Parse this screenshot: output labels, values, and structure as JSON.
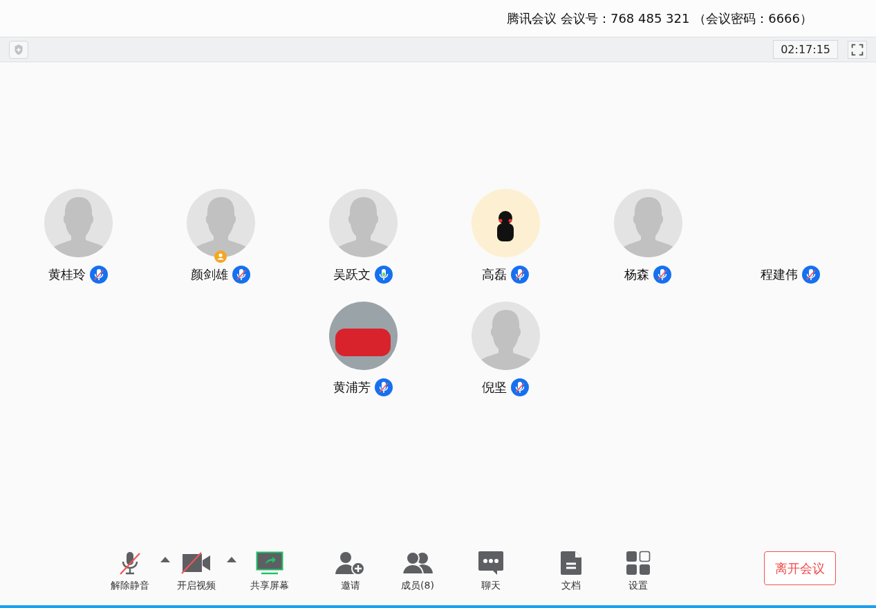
{
  "header": {
    "title": "腾讯会议 会议号：768 485 321 （会议密码：6666）"
  },
  "info_bar": {
    "timer": "02:17:15"
  },
  "participant_rows": [
    [
      {
        "name": "黄桂玲",
        "kind": "default",
        "muted": true,
        "host": false
      },
      {
        "name": "颜剑雄",
        "kind": "default",
        "muted": true,
        "host": true
      },
      {
        "name": "吴跃文",
        "kind": "default",
        "muted": false,
        "host": false
      },
      {
        "name": "高磊",
        "kind": "illustration",
        "muted": true,
        "host": false
      },
      {
        "name": "杨森",
        "kind": "default",
        "muted": true,
        "host": false
      },
      {
        "name": "程建伟",
        "kind": "none",
        "muted": true,
        "host": false
      }
    ],
    [
      {
        "name": "黄浦芳",
        "kind": "photo",
        "muted": true,
        "host": false
      },
      {
        "name": "倪坚",
        "kind": "default",
        "muted": true,
        "host": false
      }
    ]
  ],
  "toolbar": [
    {
      "kind": "mic",
      "label": "解除静音",
      "menu": true
    },
    {
      "kind": "video",
      "label": "开启视频",
      "menu": true
    },
    {
      "kind": "share",
      "label": "共享屏幕",
      "menu": false
    },
    {
      "kind": "invite",
      "label": "邀请",
      "menu": false
    },
    {
      "kind": "members",
      "label": "成员(8)",
      "menu": false
    },
    {
      "kind": "chat",
      "label": "聊天",
      "menu": false
    },
    {
      "kind": "docs",
      "label": "文档",
      "menu": false
    },
    {
      "kind": "settings",
      "label": "设置",
      "menu": false
    }
  ],
  "leave_button": "离开会议"
}
